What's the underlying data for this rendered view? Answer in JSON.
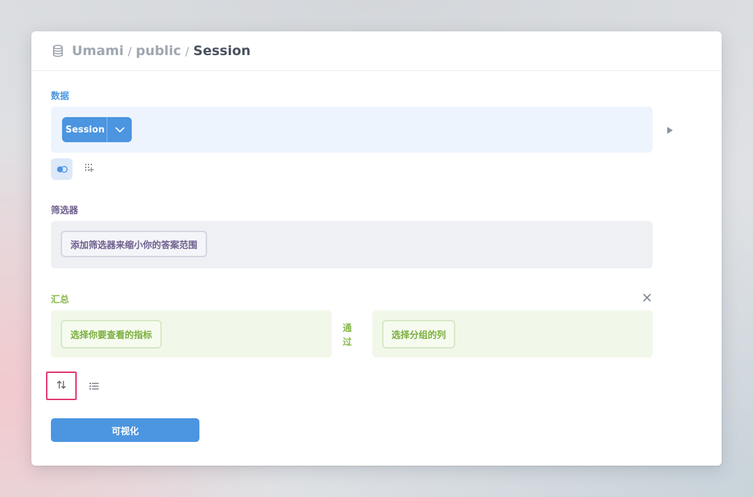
{
  "breadcrumb": {
    "items": [
      "Umami",
      "public",
      "Session"
    ],
    "separator": "/"
  },
  "sections": {
    "data": {
      "label": "数据",
      "source_button": "Session",
      "color": "#4c95e0"
    },
    "filter": {
      "label": "筛选器",
      "add_filter_placeholder": "添加筛选器来缩小你的答案范围",
      "color": "#6f5f8e"
    },
    "summarize": {
      "label": "汇总",
      "metric_placeholder": "选择你要查看的指标",
      "by_label_line1": "通",
      "by_label_line2": "过",
      "group_placeholder": "选择分组的列",
      "color": "#88b94f"
    }
  },
  "actions": {
    "visualize_label": "可视化"
  },
  "icons": {
    "header": "database-icon",
    "run": "play-icon",
    "join": "join-icon",
    "custom_column": "add-column-icon",
    "remove": "close-icon",
    "sort": "sort-icon",
    "limit": "list-icon"
  },
  "colors": {
    "accent": "#4c95e0",
    "highlight_border": "#e0336a"
  }
}
